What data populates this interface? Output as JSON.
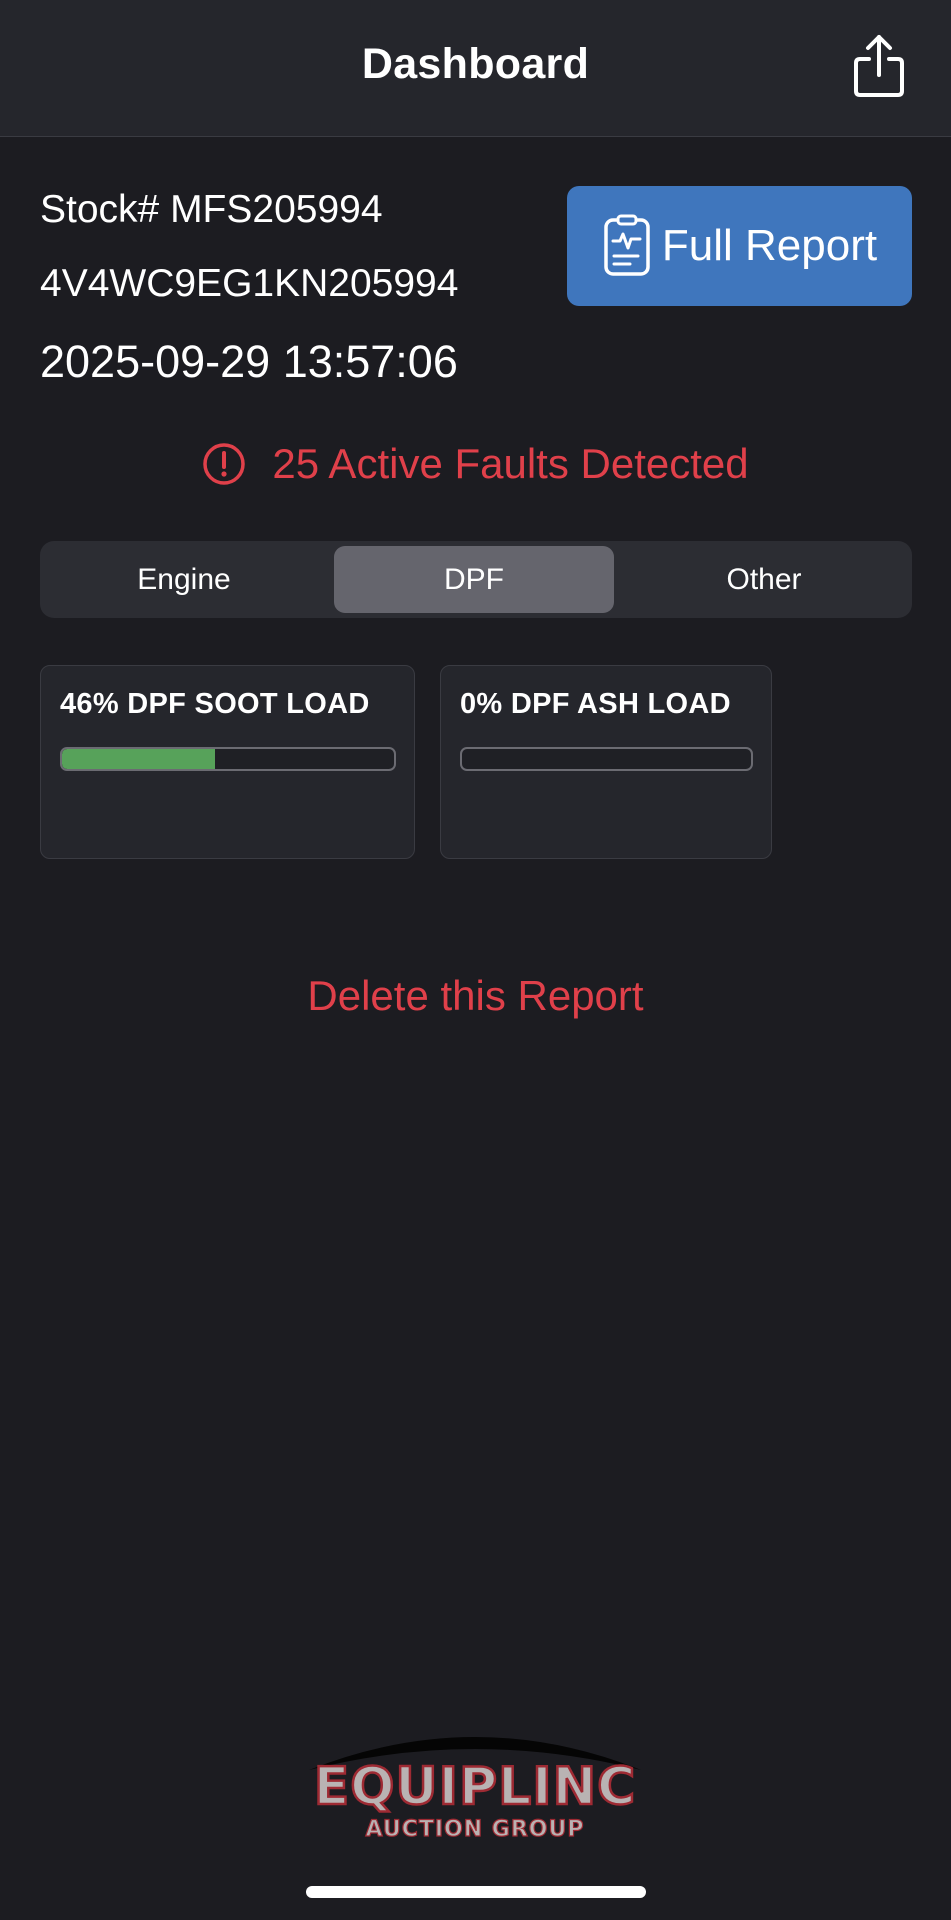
{
  "header": {
    "title": "Dashboard",
    "share_icon": "share-icon"
  },
  "vehicle": {
    "stock": "Stock# MFS205994",
    "vin": "4V4WC9EG1KN205994",
    "datetime": "2025-09-29 13:57:06"
  },
  "full_report": {
    "label": "Full Report",
    "icon": "report-pulse-icon",
    "color": "#3f76bd"
  },
  "faults": {
    "text": "25 Active Faults Detected",
    "icon": "alert-circle-icon",
    "color": "#e0404a"
  },
  "tabs": [
    {
      "label": "Engine",
      "selected": false
    },
    {
      "label": "DPF",
      "selected": true
    },
    {
      "label": "Other",
      "selected": false
    }
  ],
  "cards": [
    {
      "title": "46% DPF SOOT LOAD",
      "progress_percent": 46,
      "bar_color": "#57a25a"
    },
    {
      "title": "0% DPF ASH LOAD",
      "progress_percent": 0,
      "bar_color": "#57a25a"
    }
  ],
  "delete_label": "Delete this Report",
  "logo": {
    "name": "EQUIPLINC",
    "tagline": "AUCTION GROUP"
  }
}
